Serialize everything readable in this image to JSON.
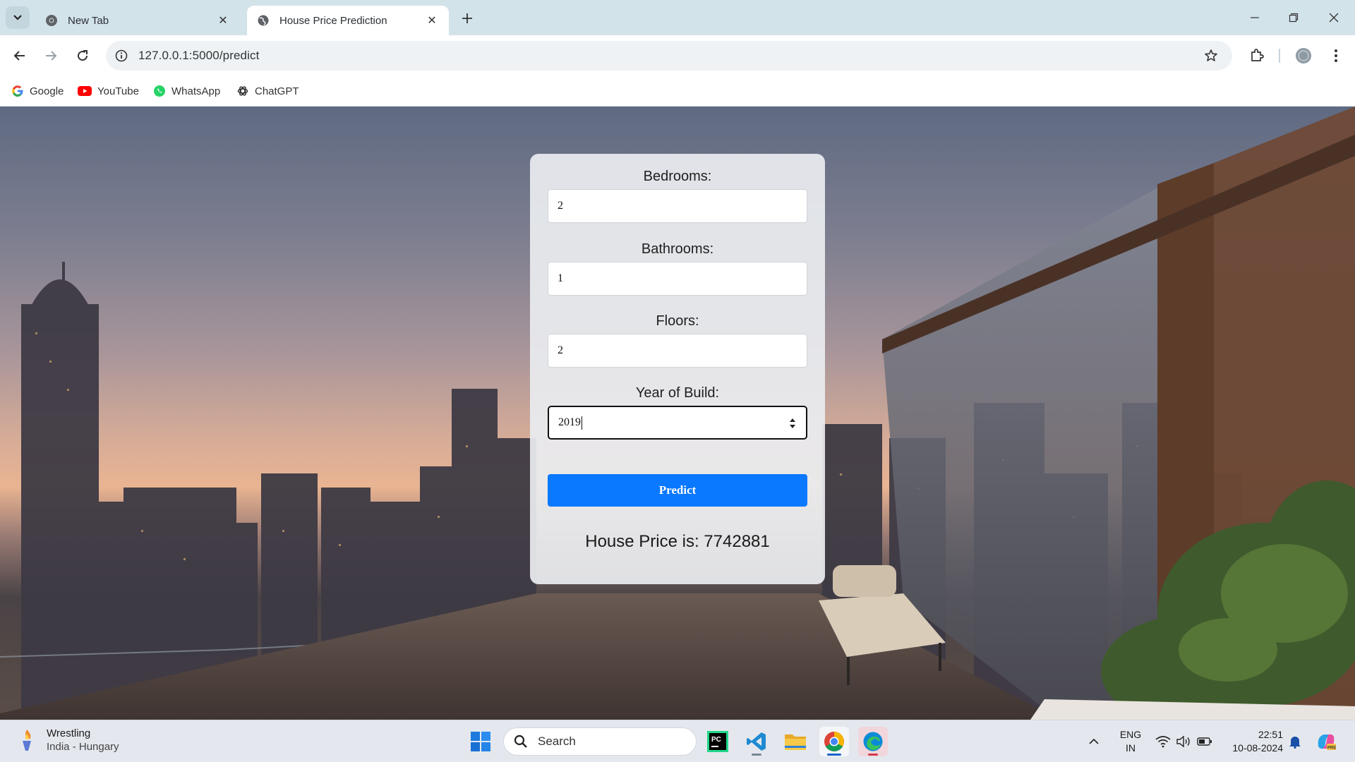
{
  "browser": {
    "tabs": [
      {
        "title": "New Tab",
        "active": false
      },
      {
        "title": "House Price Prediction",
        "active": true
      }
    ],
    "url": "127.0.0.1:5000/predict",
    "bookmarks": [
      {
        "label": "Google",
        "icon": "google-icon"
      },
      {
        "label": "YouTube",
        "icon": "youtube-icon"
      },
      {
        "label": "WhatsApp",
        "icon": "whatsapp-icon"
      },
      {
        "label": "ChatGPT",
        "icon": "chatgpt-icon"
      }
    ]
  },
  "form": {
    "fields": [
      {
        "label": "Bedrooms:",
        "value": "2"
      },
      {
        "label": "Bathrooms:",
        "value": "1"
      },
      {
        "label": "Floors:",
        "value": "2"
      },
      {
        "label": "Year of Build:",
        "value": "2019"
      }
    ],
    "predict_label": "Predict",
    "result_text": "House Price is: 7742881"
  },
  "taskbar": {
    "weather_title": "Wrestling",
    "weather_subtitle": "India - Hungary",
    "search_placeholder": "Search",
    "language_top": "ENG",
    "language_bottom": "IN",
    "time": "22:51",
    "date": "10-08-2024"
  },
  "colors": {
    "accent": "#0a78ff",
    "tabstrip": "#d3e3ea",
    "taskbar": "#e4e8ee"
  }
}
